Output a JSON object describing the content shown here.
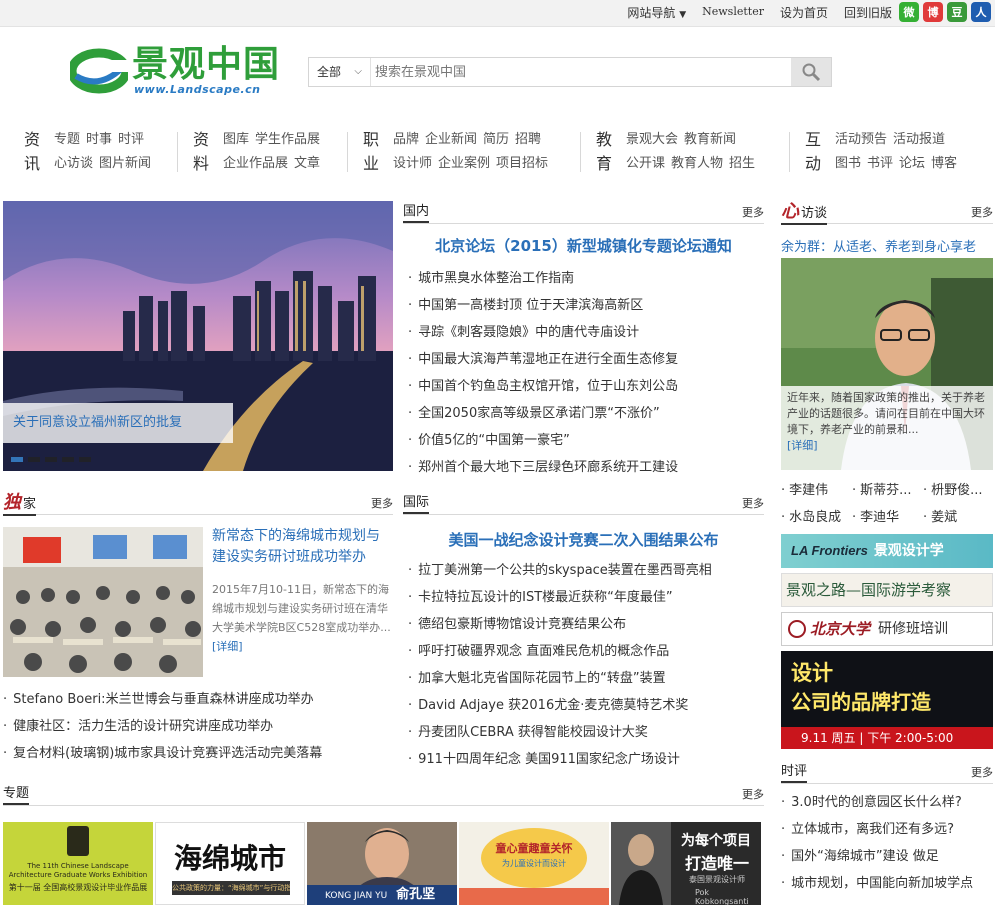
{
  "topbar": {
    "site_nav": "网站导航",
    "newsletter": "Newsletter",
    "set_home": "设为首页",
    "old_version": "回到旧版",
    "social": [
      {
        "name": "wechat-icon",
        "color": "#35b034",
        "glyph": "微"
      },
      {
        "name": "weibo-icon",
        "color": "#e03a3a",
        "glyph": "博"
      },
      {
        "name": "douban-icon",
        "color": "#3a9a3a",
        "glyph": "豆"
      },
      {
        "name": "renren-icon",
        "color": "#1f5db0",
        "glyph": "人"
      }
    ]
  },
  "logo": {
    "cn": "景观中国",
    "url": "www.Landscape.cn"
  },
  "search": {
    "scope": "全部",
    "placeholder": "搜索在景观中国"
  },
  "nav": [
    {
      "big": [
        "资",
        "讯"
      ],
      "rows": [
        [
          "专题",
          "时事",
          "时评"
        ],
        [
          "心访谈",
          "图片新闻"
        ]
      ]
    },
    {
      "big": [
        "资",
        "料"
      ],
      "rows": [
        [
          "图库",
          "学生作品展"
        ],
        [
          "企业作品展",
          "文章"
        ]
      ]
    },
    {
      "big": [
        "职",
        "业"
      ],
      "rows": [
        [
          "品牌",
          "企业新闻",
          "简历",
          "招聘"
        ],
        [
          "设计师",
          "企业案例",
          "项目招标"
        ]
      ]
    },
    {
      "big": [
        "教",
        "育"
      ],
      "rows": [
        [
          "景观大会",
          "教育新闻"
        ],
        [
          "公开课",
          "教育人物",
          "招生"
        ]
      ]
    },
    {
      "big": [
        "互",
        "动"
      ],
      "rows": [
        [
          "活动预告",
          "活动报道"
        ],
        [
          "图书",
          "书评",
          "论坛",
          "博客"
        ]
      ]
    }
  ],
  "hero": {
    "caption": "关于同意设立福州新区的批复"
  },
  "domestic": {
    "title": "国内",
    "more": "更多",
    "headline": "北京论坛（2015）新型城镇化专题论坛通知",
    "items": [
      "城市黑臭水体整治工作指南",
      "中国第一高楼封顶 位于天津滨海高新区",
      "寻踪《刺客聂隐娘》中的唐代寺庙设计",
      "中国最大滨海芦苇湿地正在进行全面生态修复",
      "中国首个钓鱼岛主权馆开馆，位于山东刘公岛",
      "全国2050家高等级景区承诺门票“不涨价”",
      "价值5亿的“中国第一豪宅”",
      "郑州首个最大地下三层绿色环廊系统开工建设"
    ]
  },
  "exclusive": {
    "title_red": "独",
    "title": "家",
    "more": "更多",
    "feature_title": "新常态下的海绵城市规划与建设实务研讨班成功举办",
    "feature_desc": "2015年7月10-11日，新常态下的海绵城市规划与建设实务研讨班在清华大学美术学院B区C528室成功举办...",
    "detail": "[详细]",
    "items": [
      "Stefano Boeri:米兰世博会与垂直森林讲座成功举办",
      "健康社区：活力生活的设计研究讲座成功举办",
      "复合材料(玻璃钢)城市家具设计竞赛评选活动完美落幕"
    ]
  },
  "international": {
    "title": "国际",
    "more": "更多",
    "headline": "美国一战纪念设计竞赛二次入围结果公布",
    "items": [
      "拉丁美洲第一个公共的skyspace装置在墨西哥亮相",
      "卡拉特拉瓦设计的IST楼最近获称“年度最佳”",
      "德绍包豪斯博物馆设计竞赛结果公布",
      "呼吁打破疆界观念 直面难民危机的概念作品",
      "加拿大魁北克省国际花园节上的“转盘”装置",
      "David Adjaye 获2016尤金·麦克德莫特艺术奖",
      "丹麦团队CEBRA 获得智能校园设计大奖",
      "911十四周年纪念 美国911国家纪念广场设计"
    ]
  },
  "interview": {
    "title_red": "心",
    "title": "访谈",
    "more": "更多",
    "feature_title": "余为群：从适老、养老到身心享老",
    "feature_desc": "近年来，随着国家政策的推出，关于养老产业的话题很多。请问在目前在中国大环境下，养老产业的前景和...",
    "detail": "[详细]",
    "names": [
      [
        "李建伟",
        "斯蒂芬...",
        "枡野俊..."
      ],
      [
        "水岛良成",
        "李迪华",
        "姜斌"
      ]
    ]
  },
  "banners": {
    "b1_en": "LA Frontiers",
    "b1_cn": "景观设计学",
    "b2": "景观之路—国际游学考察",
    "b3_uni": "北京大学",
    "b3_cls": "研修班培训",
    "b4_l1": "设计",
    "b4_l2": "公司的品牌打造",
    "b4_l3": "9.11 周五 | 下午 2:00-5:00"
  },
  "commentary": {
    "title": "时评",
    "more": "更多",
    "items": [
      "3.0时代的创意园区长什么样?",
      "立体城市，离我们还有多远?",
      "国外“海绵城市”建设 做足",
      "城市规划，中国能向新加坡学点"
    ]
  },
  "topics": {
    "title": "专题",
    "more": "更多",
    "t1_en": "The 11th Chinese Landscape Architecture Graduate Works Exhibition",
    "t1_cn": "第十一届 全国高校景观设计毕业作品展",
    "t2": "海绵城市",
    "t2_sub": "公共政策的力量：“海绵城市”与行动指南",
    "t3_en": "KONG JIAN YU",
    "t3_cn": "俞孔坚",
    "t4": "童心童趣童关怀",
    "t4_sub": "为儿童设计而设计",
    "t5_l1": "为每个项目",
    "t5_l2": "打造唯一",
    "t5_sub": "泰国景观设计师",
    "t5_name": "Pok Kobkongsanti"
  }
}
